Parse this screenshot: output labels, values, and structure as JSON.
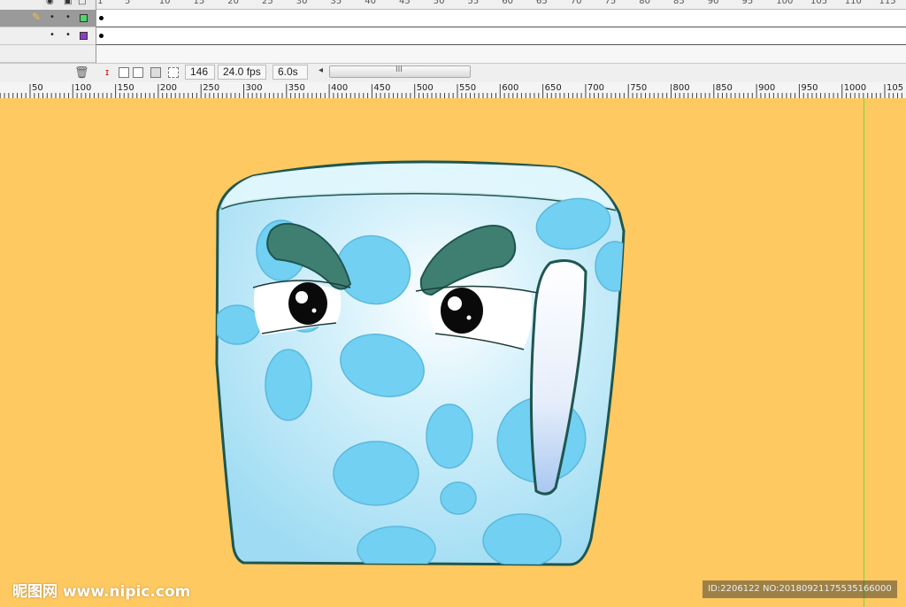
{
  "timeline": {
    "frame_numbers": [
      "1",
      "5",
      "10",
      "15",
      "20",
      "25",
      "30",
      "35",
      "40",
      "45",
      "50",
      "55",
      "60",
      "65",
      "70",
      "75",
      "80",
      "85",
      "90",
      "95",
      "100",
      "105",
      "110",
      "115"
    ],
    "layers": [
      {
        "selected": true,
        "color": "#4fd86a"
      },
      {
        "selected": false,
        "color": "#8a3ec8"
      }
    ],
    "current_frame": "146",
    "frame_rate": "24.0 fps",
    "elapsed_time": "6.0s",
    "scroll_grip": "III"
  },
  "stage_ruler": {
    "labels": [
      "50",
      "100",
      "150",
      "200",
      "250",
      "300",
      "350",
      "400",
      "450",
      "500",
      "550",
      "600",
      "650",
      "700",
      "750",
      "800",
      "850",
      "900",
      "950",
      "1000",
      "105"
    ]
  },
  "stage": {
    "background_color": "#fec961",
    "guide_color": "#7fd13a"
  },
  "character": {
    "description_icon": "ice-cube-character",
    "ice_color": "#a9e2f7",
    "spot_color": "#72d0f2",
    "outline_color": "#1f5650",
    "brow_color": "#3f7f72"
  },
  "watermark": {
    "left_text": "昵图网 www.nipic.com",
    "right_text": "ID:2206122 NO:20180921175535166000"
  }
}
